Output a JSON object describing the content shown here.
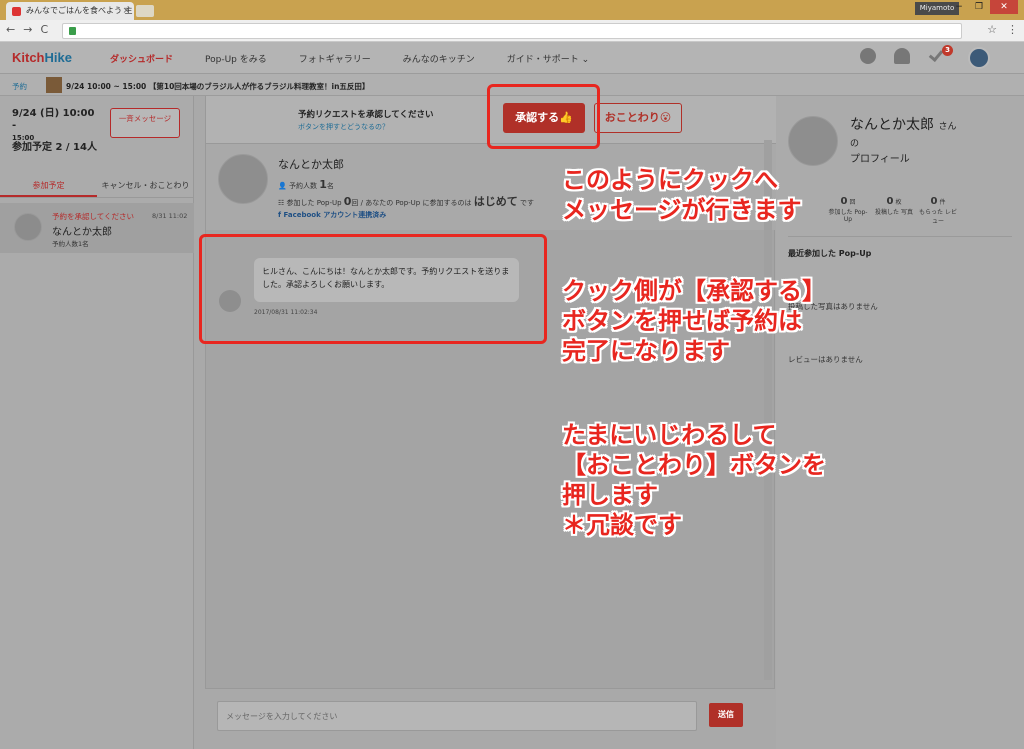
{
  "browser": {
    "tab_title": "みんなでごはんを食べよう 主",
    "tab_close": "×",
    "user_name": "Miyamoto",
    "window_min": "−",
    "window_max": "❐",
    "window_close": "✕",
    "nav_back": "←",
    "nav_forward": "→",
    "nav_reload": "C",
    "star_icon": "☆",
    "menu_icon": "⋮"
  },
  "header": {
    "logo_kitch": "Kitch",
    "logo_hike": "Hike",
    "menu": [
      "ダッシュボード",
      "Pop-Up をみる",
      "フォトギャラリー",
      "みんなのキッチン",
      "ガイド・サポート ⌄"
    ],
    "notification_count": "3"
  },
  "breadcrumb": {
    "root": "予約",
    "event": "9/24 10:00 ~ 15:00 【第10回本場のブラジル人が作るブラジル料理教室！in五反田】"
  },
  "left_panel": {
    "date": "9/24 (日) 10:00 -",
    "date_end": "15:00",
    "attendance": "参加予定 2 / 14人",
    "bulk_message_button": "一斉メッセージ",
    "tabs": [
      "参加予定",
      "キャンセル・おことわり"
    ],
    "item": {
      "status": "予約を承認してください",
      "time": "8/31 11:02",
      "name": "なんとか太郎",
      "sub": "予約人数1名"
    }
  },
  "center": {
    "request_title": "予約リクエストを承認してください",
    "request_link": "ボタンを押すとどうなるの？",
    "approve_button": "承認する👍",
    "decline_button": "おことわり😮",
    "user_name": "なんとか太郎",
    "reservation_label": "予約人数",
    "reservation_count": "1",
    "reservation_unit": "名",
    "participated_label": "参加した Pop-Up",
    "participated_count": "0",
    "participated_unit": "回 / あなたの Pop-Up に参加するのは",
    "first_time": "はじめて",
    "first_time_suffix": "です",
    "facebook": "Facebook アカウント連携済み",
    "message_text": "ヒルさん、こんにちは！なんとか太郎です。予約リクエストを送りました。承認よろしくお願いします。",
    "message_time": "2017/08/31 11:02:34",
    "composer_placeholder": "メッセージを入力してください",
    "send_button": "送信"
  },
  "right_panel": {
    "name": "なんとか太郎",
    "san": "さん",
    "no": "の",
    "profile": "プロフィール",
    "stats": [
      {
        "value": "0",
        "unit": "回",
        "label": "参加した Pop-Up"
      },
      {
        "value": "0",
        "unit": "枚",
        "label": "投稿した 写真"
      },
      {
        "value": "0",
        "unit": "件",
        "label": "もらった レビュー"
      }
    ],
    "recent_title": "最近参加した Pop-Up",
    "empty_photos": "投稿した写真はありません",
    "empty_reviews": "レビューはありません"
  },
  "annotations": {
    "a1_line1": "このようにクックへ",
    "a1_line2": "メッセージが行きます",
    "a2_line1": "クック側が【承認する】",
    "a2_line2": "ボタンを押せば予約は",
    "a2_line3": "完了になります",
    "a3_line1": "たまにいじわるして",
    "a3_line2": "【おことわり】ボタンを",
    "a3_line3": "押します",
    "a3_line4": "＊冗談です"
  }
}
